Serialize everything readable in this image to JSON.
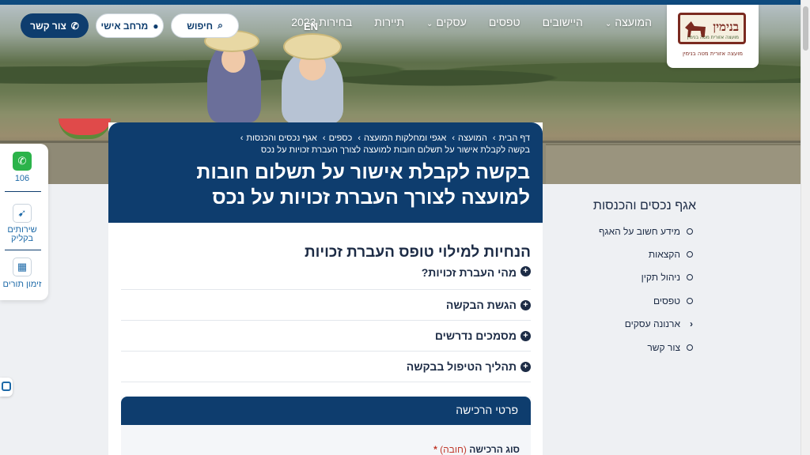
{
  "brand": {
    "logo_wordmark": "בנימין",
    "logo_sub": "מועצה אזורית מטה בנימין",
    "logo_caption": "מועצה אזורית מטה בנימין"
  },
  "nav": {
    "items": [
      {
        "label": "המועצה",
        "dropdown": true
      },
      {
        "label": "היישובים",
        "dropdown": false
      },
      {
        "label": "טפסים",
        "dropdown": false
      },
      {
        "label": "עסקים",
        "dropdown": true
      },
      {
        "label": "תיירות",
        "dropdown": false
      },
      {
        "label": "בחירות 2023",
        "dropdown": false
      }
    ],
    "lang": "EN",
    "search_label": "חיפוש",
    "personal_label": "מרחב אישי",
    "contact_label": "צור קשר"
  },
  "float": {
    "whatsapp_label": "106",
    "services_label": "שירותים בקליק",
    "appointments_label": "זימון תורים"
  },
  "card": {
    "breadcrumbs": [
      "דף הבית",
      "המועצה",
      "אגפי ומחלקות המועצה",
      "כספים",
      "אגף נכסים והכנסות"
    ],
    "crumb_sep": "›",
    "current": "בקשה לקבלת אישור על תשלום חובות למועצה לצורך העברת זכויות על נכס",
    "title_line1": "בקשה לקבלת אישור על תשלום חובות",
    "title_line2": "למועצה לצורך העברת זכויות על נכס",
    "section_title": "הנחיות למילוי טופס העברת זכויות",
    "accordions": [
      "מהי העברת זכויות?",
      "הגשת הבקשה",
      "מסמכים נדרשים",
      "תהליך הטיפול בבקשה"
    ],
    "panel_title": "פרטי הרכישה",
    "field_label": "סוג הרכישה",
    "field_req": "(חובה)",
    "field_star": "*"
  },
  "sidebar": {
    "title": "אגף נכסים והכנסות",
    "items": [
      {
        "label": "מידע חשוב על האגף",
        "active": false
      },
      {
        "label": "הקצאות",
        "active": false
      },
      {
        "label": "ניהול תקין",
        "active": false
      },
      {
        "label": "טפסים",
        "active": false
      },
      {
        "label": "ארנונה עסקים",
        "active": true
      },
      {
        "label": "צור קשר",
        "active": false
      }
    ]
  },
  "colors": {
    "primary": "#0e3d6e",
    "text": "#1c2b45",
    "link": "#1e6aa8",
    "whatsapp": "#2bb34a"
  }
}
